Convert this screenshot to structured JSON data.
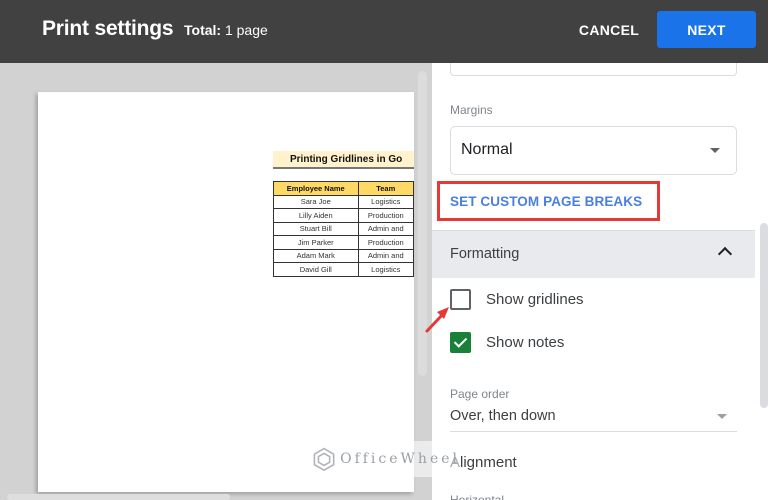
{
  "header": {
    "title": "Print settings",
    "total_label": "Total:",
    "total_value": "1 page",
    "cancel_label": "CANCEL",
    "next_label": "NEXT",
    "accent_color": "#1a73e8"
  },
  "preview": {
    "sheet_title": "Printing Gridlines in Go",
    "columns": [
      "Employee Name",
      "Team"
    ],
    "rows": [
      [
        "Sara Joe",
        "Logistics"
      ],
      [
        "Lilly Aiden",
        "Production"
      ],
      [
        "Stuart Bill",
        "Admin and"
      ],
      [
        "Jim Parker",
        "Production"
      ],
      [
        "Adam Mark",
        "Admin and"
      ],
      [
        "David Gill",
        "Logistics"
      ]
    ]
  },
  "settings": {
    "margins_label": "Margins",
    "margins_value": "Normal",
    "custom_breaks_label": "SET CUSTOM PAGE BREAKS",
    "formatting_label": "Formatting",
    "show_gridlines_label": "Show gridlines",
    "show_gridlines_checked": false,
    "show_notes_label": "Show notes",
    "show_notes_checked": true,
    "page_order_label": "Page order",
    "page_order_value": "Over, then down",
    "alignment_label": "Alignment",
    "horizontal_label": "Horizontal"
  },
  "watermark": {
    "text": "OfficeWheel"
  }
}
